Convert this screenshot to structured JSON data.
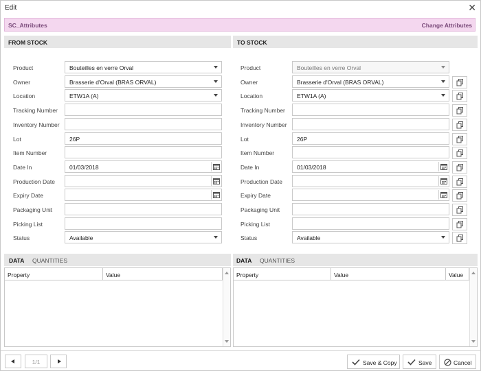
{
  "window": {
    "title": "Edit"
  },
  "attributes_bar": {
    "name": "SC_Attributes",
    "change_label": "Change Attributes"
  },
  "from_stock": {
    "header": "FROM STOCK",
    "fields": [
      {
        "label": "Product",
        "value": "Bouteilles en verre Orval",
        "kind": "select"
      },
      {
        "label": "Owner",
        "value": "Brasserie d'Orval (BRAS ORVAL)",
        "kind": "select"
      },
      {
        "label": "Location",
        "value": "ETW1A (A)",
        "kind": "select"
      },
      {
        "label": "Tracking Number",
        "value": "",
        "kind": "text"
      },
      {
        "label": "Inventory Number",
        "value": "",
        "kind": "text"
      },
      {
        "label": "Lot",
        "value": "26P",
        "kind": "text"
      },
      {
        "label": "Item Number",
        "value": "",
        "kind": "text"
      },
      {
        "label": "Date In",
        "value": "01/03/2018",
        "kind": "date"
      },
      {
        "label": "Production Date",
        "value": "",
        "kind": "date"
      },
      {
        "label": "Expiry Date",
        "value": "",
        "kind": "date"
      },
      {
        "label": "Packaging Unit",
        "value": "",
        "kind": "text"
      },
      {
        "label": "Picking List",
        "value": "",
        "kind": "text"
      },
      {
        "label": "Status",
        "value": "Available",
        "kind": "select"
      }
    ],
    "tabs": [
      "DATA",
      "QUANTITIES"
    ],
    "grid_columns": [
      "Property",
      "Value"
    ]
  },
  "to_stock": {
    "header": "TO STOCK",
    "fields": [
      {
        "label": "Product",
        "value": "Bouteilles en verre Orval",
        "kind": "select",
        "disabled": true
      },
      {
        "label": "Owner",
        "value": "Brasserie d'Orval (BRAS ORVAL)",
        "kind": "select"
      },
      {
        "label": "Location",
        "value": "ETW1A (A)",
        "kind": "select"
      },
      {
        "label": "Tracking Number",
        "value": "",
        "kind": "text"
      },
      {
        "label": "Inventory Number",
        "value": "",
        "kind": "text"
      },
      {
        "label": "Lot",
        "value": "26P",
        "kind": "text"
      },
      {
        "label": "Item Number",
        "value": "",
        "kind": "text"
      },
      {
        "label": "Date In",
        "value": "01/03/2018",
        "kind": "date"
      },
      {
        "label": "Production Date",
        "value": "",
        "kind": "date"
      },
      {
        "label": "Expiry Date",
        "value": "",
        "kind": "date"
      },
      {
        "label": "Packaging Unit",
        "value": "",
        "kind": "text"
      },
      {
        "label": "Picking List",
        "value": "",
        "kind": "text"
      },
      {
        "label": "Status",
        "value": "Available",
        "kind": "select"
      }
    ],
    "tabs": [
      "DATA",
      "QUANTITIES"
    ],
    "grid_columns": [
      "Property",
      "Value",
      "Value"
    ]
  },
  "footer": {
    "page_indicator": "1/1",
    "save_copy_label": "Save & Copy",
    "save_label": "Save",
    "cancel_label": "Cancel"
  },
  "icons": {
    "close": "close-icon",
    "dropdown": "chevron-down-icon",
    "calendar": "calendar-icon",
    "copy": "copy-icon",
    "check": "check-icon",
    "cancel": "cancel-icon"
  }
}
